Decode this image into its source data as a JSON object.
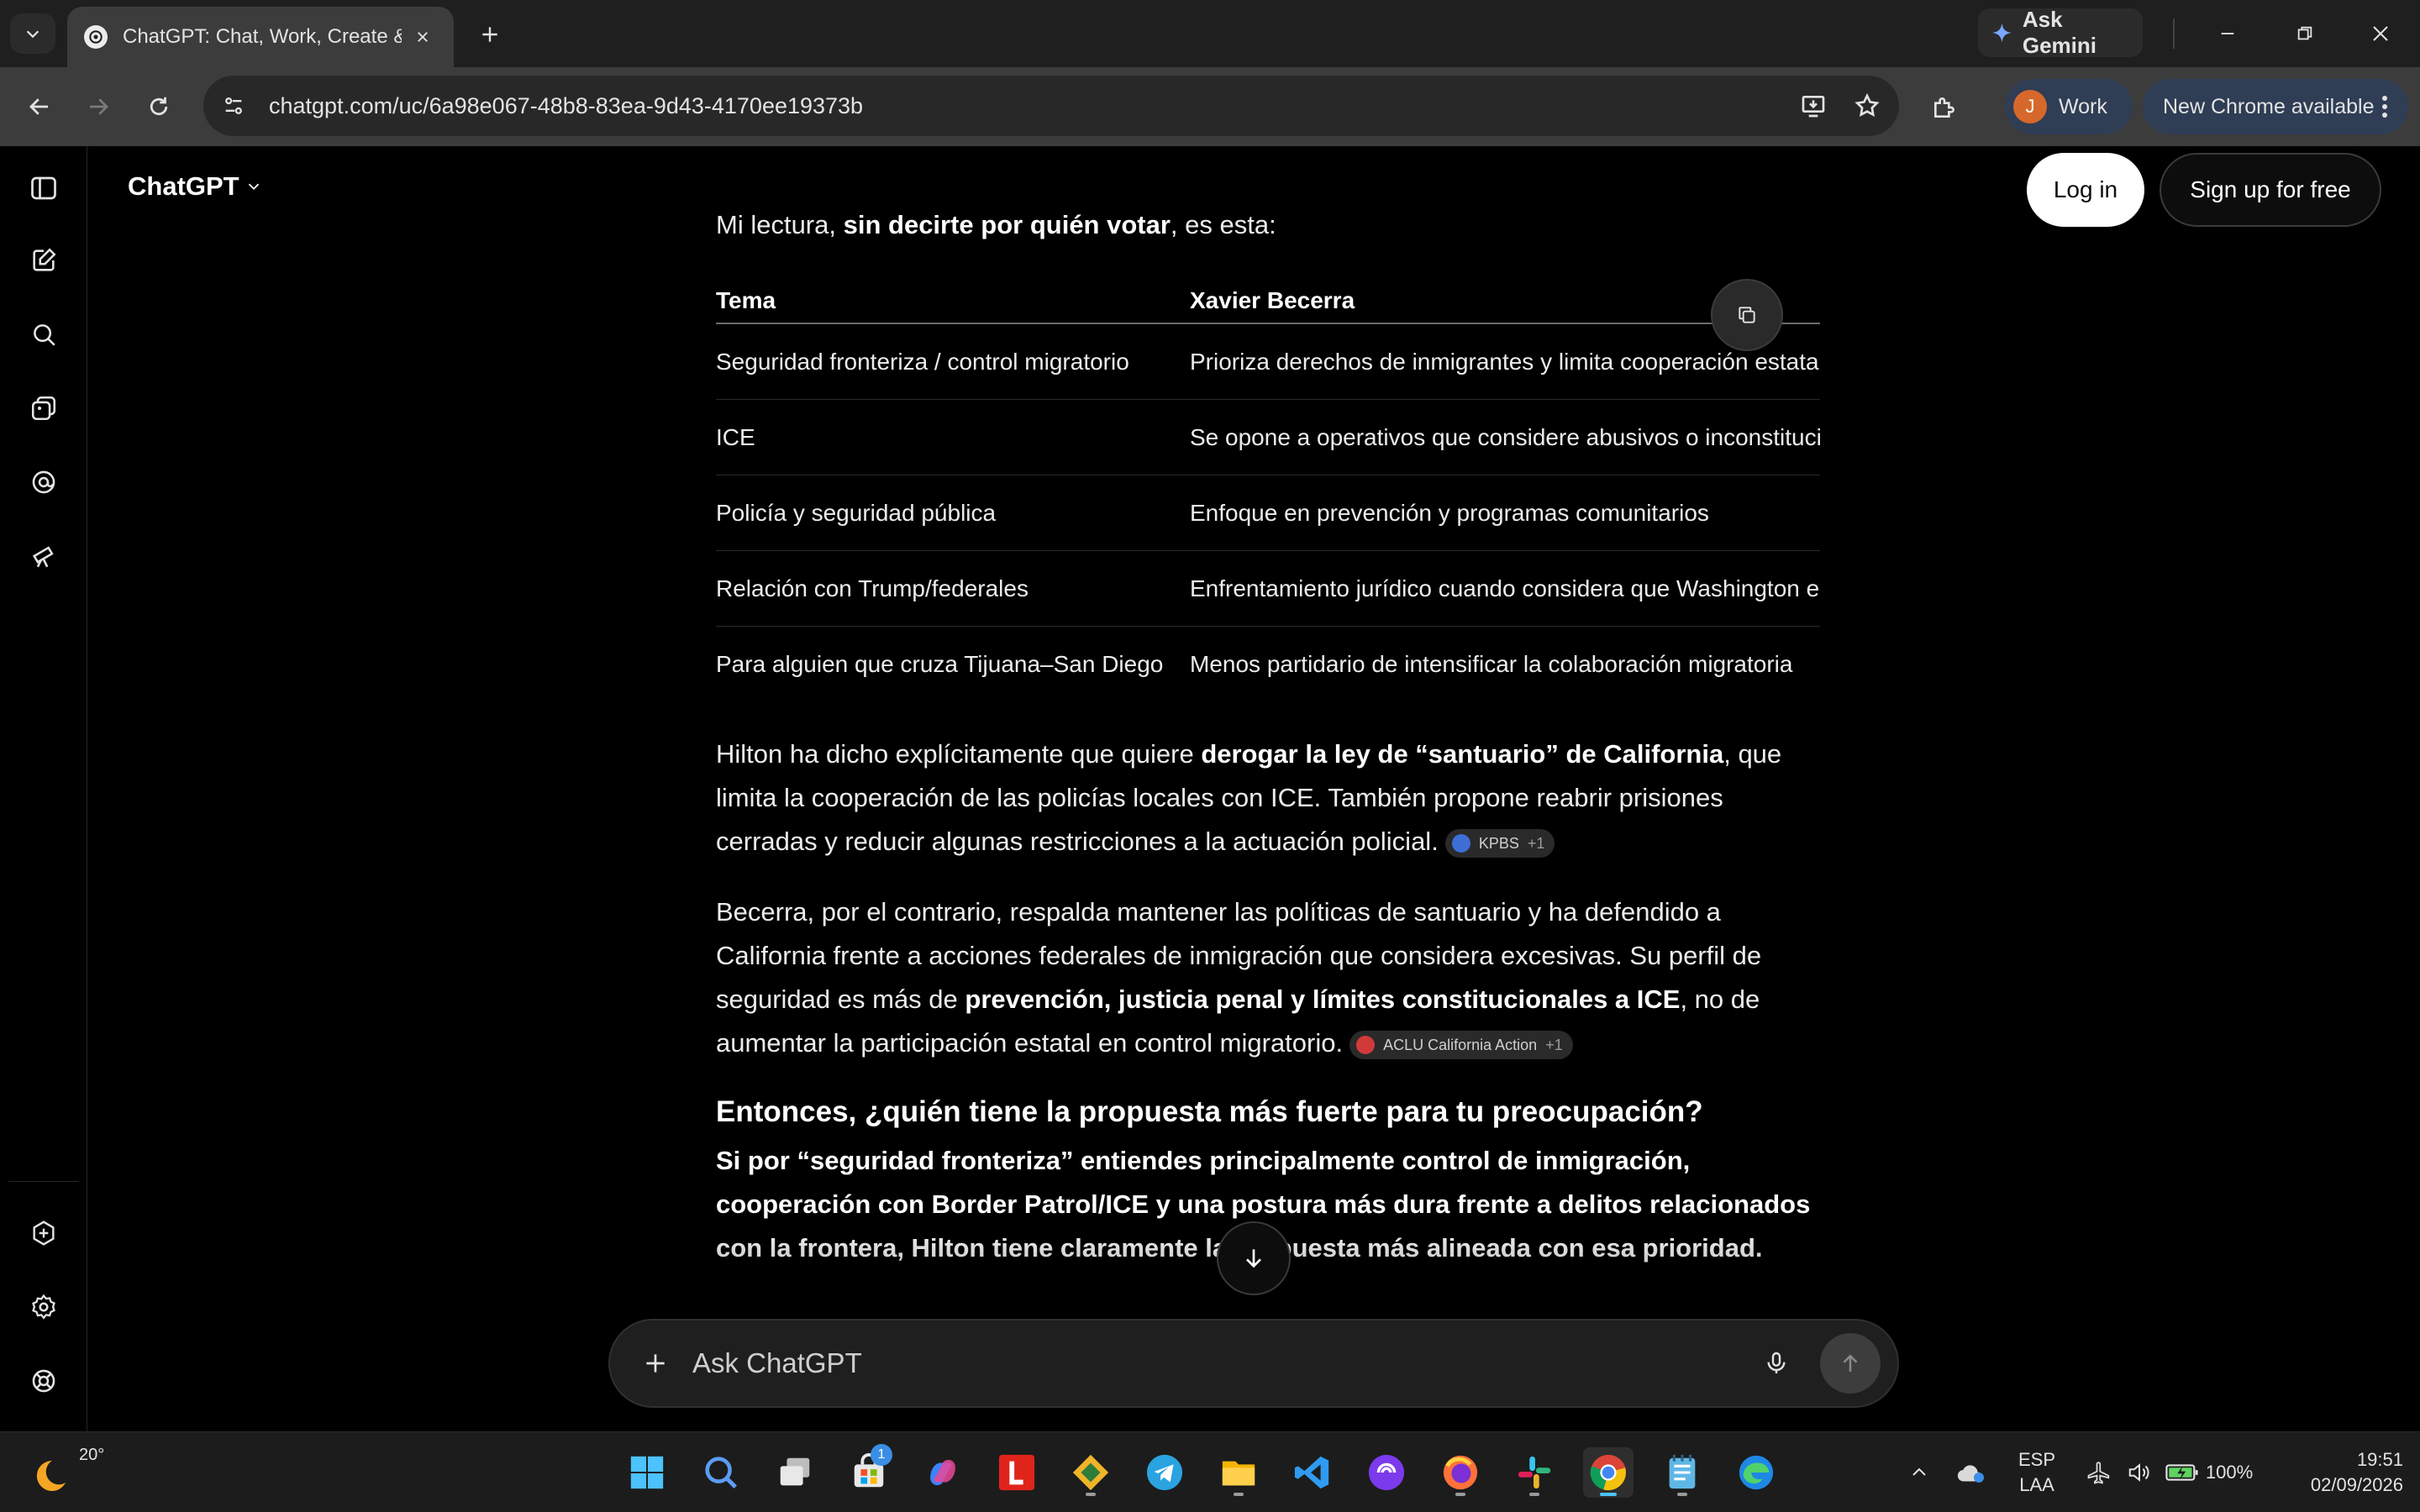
{
  "browser": {
    "tab_title": "ChatGPT: Chat, Work, Create &",
    "url": "chatgpt.com/uc/6a98e067-48b8-83ea-9d43-4170ee19373b",
    "gemini_label": "Ask Gemini",
    "profile_initial": "J",
    "profile_label": "Work",
    "update_label": "New Chrome available"
  },
  "header": {
    "model_label": "ChatGPT",
    "login_label": "Log in",
    "signup_label": "Sign up for free"
  },
  "message": {
    "intro_prefix": "Mi lectura, ",
    "intro_bold": "sin decirte por quién votar",
    "intro_suffix": ", es esta:",
    "table": {
      "headers": [
        "Tema",
        "Xavier Becerra"
      ],
      "rows": [
        [
          "Seguridad fronteriza / control migratorio",
          "Prioriza derechos de inmigrantes y limita cooperación estatal"
        ],
        [
          "ICE",
          "Se opone a operativos que considere abusivos o inconstitucionales"
        ],
        [
          "Policía y seguridad pública",
          "Enfoque en prevención y programas comunitarios"
        ],
        [
          "Relación con Trump/federales",
          "Enfrentamiento jurídico cuando considera que Washington e"
        ],
        [
          "Para alguien que cruza Tijuana–San Diego",
          "Menos partidario de intensificar la colaboración migratoria"
        ]
      ]
    },
    "para1": {
      "a": "Hilton ha dicho explícitamente que quiere ",
      "b": "derogar la ley de “santuario” de California",
      "c": ", que limita la cooperación de las policías locales con ICE. También propone reabrir prisiones cerradas y reducir algunas restricciones a la actuación policial.",
      "cite_label": "KPBS",
      "cite_more": "+1"
    },
    "para2": {
      "a": "Becerra, por el contrario, respalda mantener las políticas de santuario y ha defendido a California frente a acciones federales de inmigración que considera excesivas. Su perfil de seguridad es más de ",
      "b": "prevención, justicia penal y límites constitucionales a ICE",
      "c": ", no de aumentar la participación estatal en control migratorio.",
      "cite_label": "ACLU California Action",
      "cite_more": "+1"
    },
    "heading": "Entonces, ¿quién tiene la propuesta más fuerte para tu preocupación?",
    "para3": "Si por “seguridad fronteriza” entiendes principalmente control de inmigración, cooperación con Border Patrol/ICE y una postura más dura frente a delitos relacionados con la frontera, Hilton tiene claramente la propuesta más alineada con esa prioridad."
  },
  "composer": {
    "placeholder": "Ask ChatGPT"
  },
  "taskbar": {
    "temperature": "20°",
    "store_badge": "1",
    "lang_top": "ESP",
    "lang_bottom": "LAA",
    "battery": "100%",
    "time": "19:51",
    "date": "02/09/2026"
  },
  "colors": {
    "accent_blue": "#4cc2ff",
    "profile_orange": "#d7682b",
    "kpbs_dot": "#3d6fd6",
    "aclu_dot": "#d23a3a"
  }
}
